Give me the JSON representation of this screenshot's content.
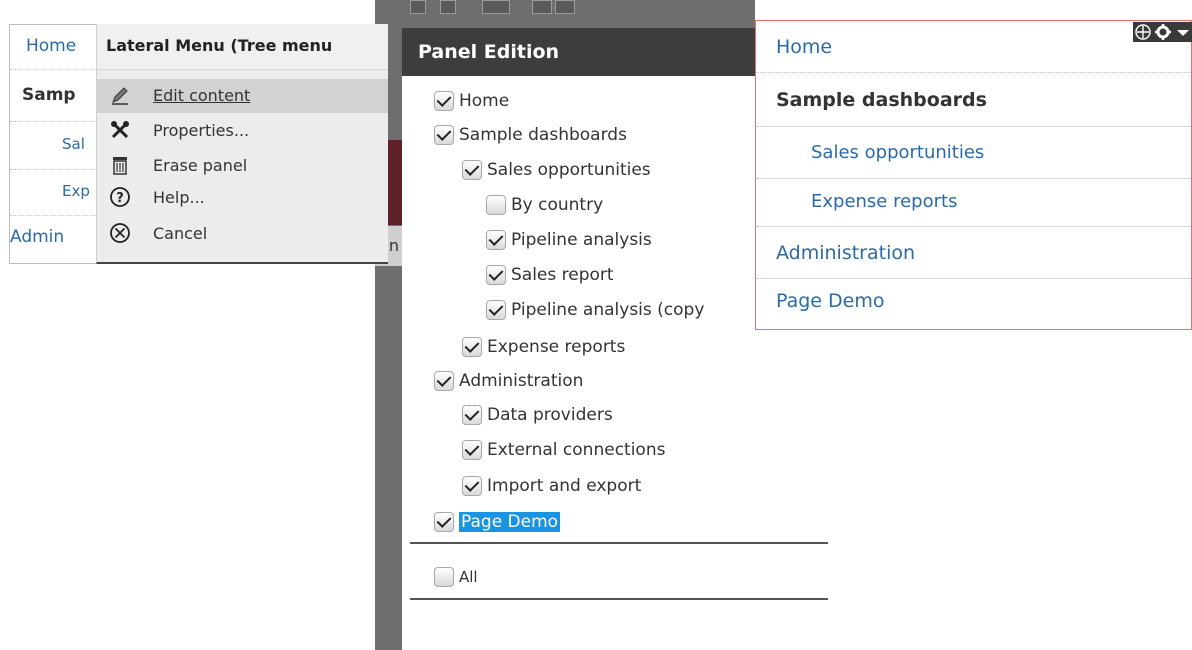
{
  "tree_menu": {
    "items": [
      {
        "label": "Home"
      },
      {
        "label": "Samp"
      },
      {
        "label": "Sal"
      },
      {
        "label": "Exp"
      },
      {
        "label": "Admin"
      }
    ]
  },
  "context_menu": {
    "title": "Lateral Menu (Tree menu",
    "items": [
      {
        "label": "Edit content",
        "icon": "pencil-icon"
      },
      {
        "label": "Properties...",
        "icon": "tools-icon"
      },
      {
        "label": "Erase panel",
        "icon": "trash-icon"
      },
      {
        "label": "Help...",
        "icon": "help-icon"
      },
      {
        "label": "Cancel",
        "icon": "cancel-icon"
      }
    ]
  },
  "background": {
    "strip_text": "en"
  },
  "panel_edition": {
    "title": "Panel Edition",
    "items": [
      {
        "label": "Home",
        "checked": true,
        "level": 0
      },
      {
        "label": "Sample dashboards",
        "checked": true,
        "level": 0
      },
      {
        "label": "Sales opportunities",
        "checked": true,
        "level": 1
      },
      {
        "label": "By country",
        "checked": false,
        "level": 2
      },
      {
        "label": "Pipeline analysis",
        "checked": true,
        "level": 2
      },
      {
        "label": "Sales report",
        "checked": true,
        "level": 2
      },
      {
        "label": "Pipeline analysis (copy",
        "checked": true,
        "level": 2
      },
      {
        "label": "Expense reports",
        "checked": true,
        "level": 1
      },
      {
        "label": "Administration",
        "checked": true,
        "level": 0
      },
      {
        "label": "Data providers",
        "checked": true,
        "level": 1
      },
      {
        "label": "External connections",
        "checked": true,
        "level": 1
      },
      {
        "label": "Import and export",
        "checked": true,
        "level": 1
      },
      {
        "label": "Page Demo",
        "checked": true,
        "level": 0,
        "selected": true
      }
    ],
    "all_label": "All",
    "all_checked": false
  },
  "preview_menu": {
    "items": [
      {
        "label": "Home"
      },
      {
        "label": "Sample dashboards"
      },
      {
        "label": "Sales opportunities"
      },
      {
        "label": "Expense reports"
      },
      {
        "label": "Administration"
      },
      {
        "label": "Page Demo"
      }
    ],
    "tools": [
      "move-icon",
      "gear-icon",
      "dropdown-icon"
    ]
  },
  "colors": {
    "link": "#2a6aa8",
    "panel_header": "#3d3d3d",
    "selection": "#1a94e0",
    "preview_border": "#e47070"
  }
}
